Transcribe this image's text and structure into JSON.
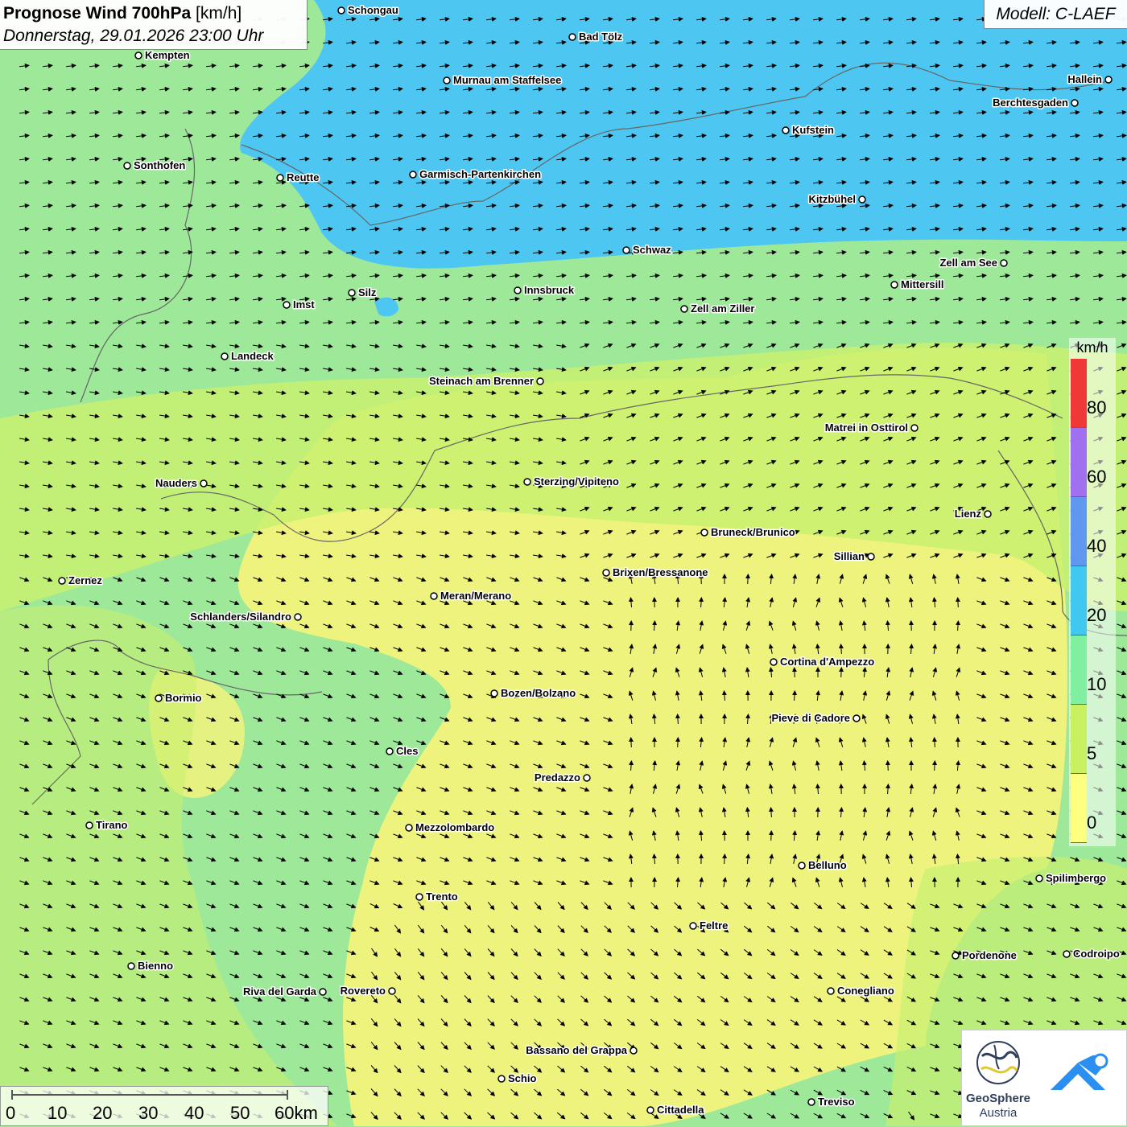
{
  "header": {
    "title_main": "Prognose Wind 700hPa",
    "title_unit": "[km/h]",
    "datetime": "Donnerstag, 29.01.2026 23:00 Uhr"
  },
  "model": "Modell: C-LAEF",
  "legend": {
    "unit": "km/h",
    "classes": [
      {
        "label": "0",
        "color": "#ffff80"
      },
      {
        "label": "5",
        "color": "#c8f060"
      },
      {
        "label": "10",
        "color": "#80f0a0"
      },
      {
        "label": "20",
        "color": "#40c8f0"
      },
      {
        "label": "40",
        "color": "#6098f0"
      },
      {
        "label": "60",
        "color": "#a070f0"
      },
      {
        "label": "80",
        "color": "#f03838"
      }
    ]
  },
  "scale_bar": {
    "labels": [
      "0",
      "10",
      "20",
      "30",
      "40",
      "50",
      "60km"
    ]
  },
  "logo": {
    "name_line1": "GeoSphere",
    "name_line2": "Austria"
  },
  "cities": [
    {
      "name": "Schongau"
    },
    {
      "name": "Bad Tölz"
    },
    {
      "name": "Kempten"
    },
    {
      "name": "Murnau am Staffelsee"
    },
    {
      "name": "Hallein"
    },
    {
      "name": "Berchtesgaden"
    },
    {
      "name": "Kufstein"
    },
    {
      "name": "Sonthofen"
    },
    {
      "name": "Reutte"
    },
    {
      "name": "Garmisch-Partenkirchen"
    },
    {
      "name": "Kitzbühel"
    },
    {
      "name": "Schwaz"
    },
    {
      "name": "Zell am See"
    },
    {
      "name": "Silz"
    },
    {
      "name": "Innsbruck"
    },
    {
      "name": "Mittersill"
    },
    {
      "name": "Imst"
    },
    {
      "name": "Zell am Ziller"
    },
    {
      "name": "Landeck"
    },
    {
      "name": "Steinach am Brenner"
    },
    {
      "name": "Matrei in Osttirol"
    },
    {
      "name": "Nauders"
    },
    {
      "name": "Sterzing/Vipiteno"
    },
    {
      "name": "Lienz"
    },
    {
      "name": "Bruneck/Brunico"
    },
    {
      "name": "Sillian"
    },
    {
      "name": "Zernez"
    },
    {
      "name": "Brixen/Bressanone"
    },
    {
      "name": "Meran/Merano"
    },
    {
      "name": "Schlanders/Silandro"
    },
    {
      "name": "Cortina d'Ampezzo"
    },
    {
      "name": "Bozen/Bolzano"
    },
    {
      "name": "Bormio"
    },
    {
      "name": "Pieve di Cadore"
    },
    {
      "name": "Cles"
    },
    {
      "name": "Predazzo"
    },
    {
      "name": "Tirano"
    },
    {
      "name": "Mezzolombardo"
    },
    {
      "name": "Belluno"
    },
    {
      "name": "Spilimbergo"
    },
    {
      "name": "Trento"
    },
    {
      "name": "Feltre"
    },
    {
      "name": "Pordenone"
    },
    {
      "name": "Codroipo"
    },
    {
      "name": "Bienno"
    },
    {
      "name": "Riva del Garda"
    },
    {
      "name": "Rovereto"
    },
    {
      "name": "Conegliano"
    },
    {
      "name": "Bassano del Grappa"
    },
    {
      "name": "Schio"
    },
    {
      "name": "Treviso"
    },
    {
      "name": "Cittadella"
    }
  ]
}
